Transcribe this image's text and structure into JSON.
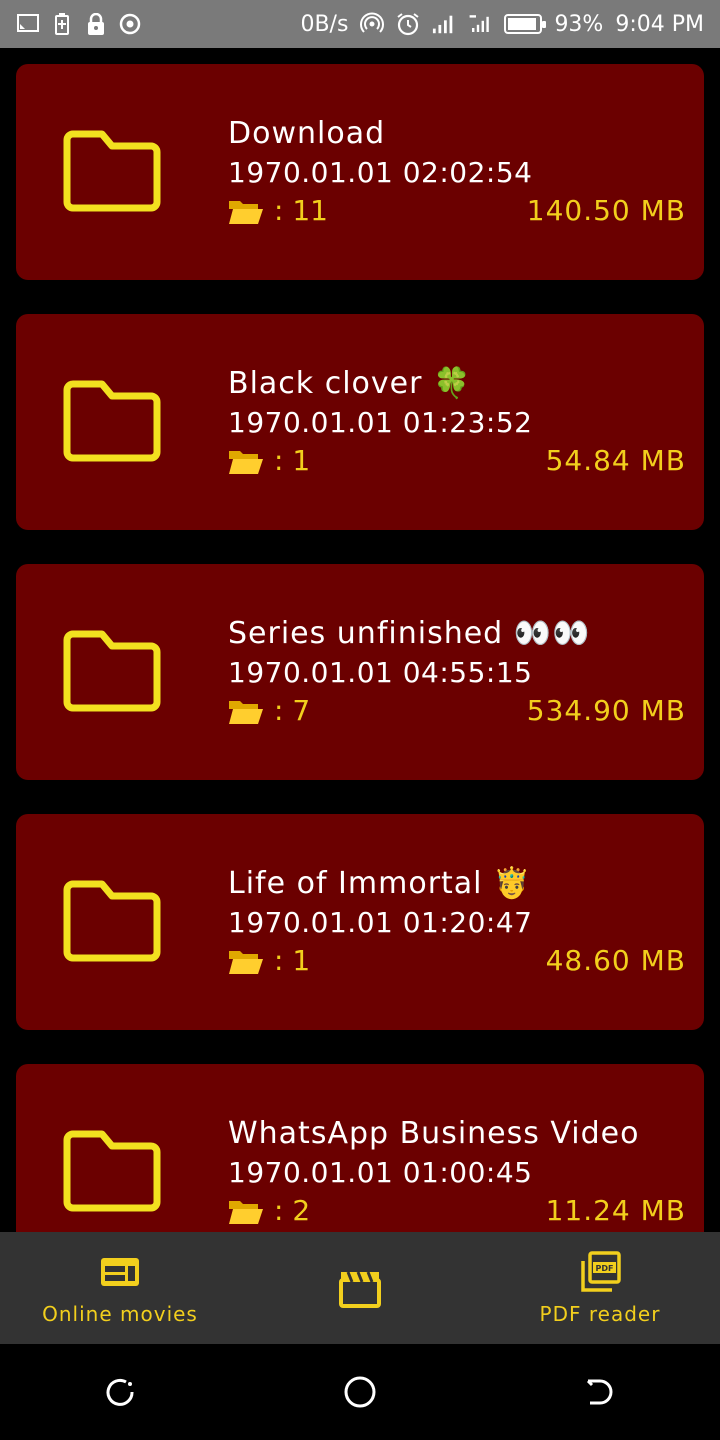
{
  "status_bar": {
    "network_speed": "0B/s",
    "battery_percent": "93%",
    "battery_level": 0.93,
    "time": "9:04 PM",
    "left_icons": [
      "cast-icon",
      "battery-saver-icon",
      "lock-icon",
      "record-icon"
    ],
    "right_icons": [
      "hotspot-icon",
      "alarm-icon",
      "signal-icon",
      "signal-4g-icon",
      "battery-icon"
    ]
  },
  "folders": [
    {
      "name": "Download",
      "date": "1970.01.01 02:02:54",
      "count": ": 11",
      "size": "140.50 MB"
    },
    {
      "name": "Black clover 🍀",
      "date": "1970.01.01 01:23:52",
      "count": ": 1",
      "size": "54.84 MB"
    },
    {
      "name": "Series unfinished 👀👀",
      "date": "1970.01.01 04:55:15",
      "count": ": 7",
      "size": "534.90 MB"
    },
    {
      "name": "Life of Immortal 🤴",
      "date": "1970.01.01 01:20:47",
      "count": ": 1",
      "size": "48.60 MB"
    },
    {
      "name": "WhatsApp Business Video",
      "date": "1970.01.01 01:00:45",
      "count": ": 2",
      "size": "11.24 MB"
    }
  ],
  "bottom_nav": {
    "online_movies": "Online movies",
    "pdf_reader": "PDF reader",
    "middle_icon": "clapperboard-icon"
  },
  "colors": {
    "card_background": "#6b0000",
    "accent": "#f2cf1d",
    "status_bar": "#7a7a7a",
    "bottom_nav": "#333333"
  }
}
